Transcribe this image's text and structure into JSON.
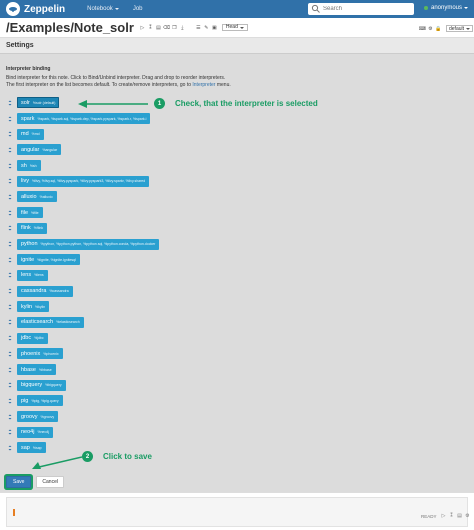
{
  "navbar": {
    "brand": "Zeppelin",
    "notebook_label": "Notebook",
    "job_label": "Job",
    "search_placeholder": "Search",
    "user": "anonymous",
    "brand_color": "#3071a9"
  },
  "note": {
    "title": "/Examples/Note_solr",
    "head_label": "Head",
    "default_label": "default"
  },
  "settings": {
    "title": "Settings",
    "binding_heading": "Interpreter binding",
    "desc_line1": "Bind interpreter for this note. Click to Bind/Unbind interpreter. Drag and drop to reorder interpreters.",
    "desc_line2_prefix": "The first interpreter on the list becomes default. To create/remove interpreters, go to ",
    "desc_link": "Interpreter",
    "desc_line2_suffix": " menu.",
    "interpreters": [
      {
        "name": "solr",
        "sub": "%solr (default)",
        "selected": true
      },
      {
        "name": "spark",
        "sub": "%spark, %spark.sql, %spark.dep, %spark.pyspark, %spark.r, %spark.i"
      },
      {
        "name": "md",
        "sub": "%md"
      },
      {
        "name": "angular",
        "sub": "%angular"
      },
      {
        "name": "sh",
        "sub": "%sh"
      },
      {
        "name": "livy",
        "sub": "%livy, %livy.sql, %livy.pyspark, %livy.pyspark3, %livy.sparkr, %livy.shared"
      },
      {
        "name": "alluxio",
        "sub": "%alluxio"
      },
      {
        "name": "file",
        "sub": "%file"
      },
      {
        "name": "flink",
        "sub": "%flink"
      },
      {
        "name": "python",
        "sub": "%python, %python.python, %python.sql, %python.conda, %python.docker"
      },
      {
        "name": "ignite",
        "sub": "%ignite, %ignite.ignitesql"
      },
      {
        "name": "lens",
        "sub": "%lens"
      },
      {
        "name": "cassandra",
        "sub": "%cassandra"
      },
      {
        "name": "kylin",
        "sub": "%kylin"
      },
      {
        "name": "elasticsearch",
        "sub": "%elasticsearch"
      },
      {
        "name": "jdbc",
        "sub": "%jdbc"
      },
      {
        "name": "phoenix",
        "sub": "%phoenix"
      },
      {
        "name": "hbase",
        "sub": "%hbase"
      },
      {
        "name": "bigquery",
        "sub": "%bigquery"
      },
      {
        "name": "pig",
        "sub": "%pig, %pig.query"
      },
      {
        "name": "groovy",
        "sub": "%groovy"
      },
      {
        "name": "neo4j",
        "sub": "%neo4j"
      },
      {
        "name": "sap",
        "sub": "%sap"
      }
    ],
    "save_label": "Save",
    "cancel_label": "Cancel"
  },
  "annotations": {
    "step1_number": "1",
    "step1_text": "Check, that the interpreter is selected",
    "step2_number": "2",
    "step2_text": "Click to save",
    "color": "#1a9c64"
  },
  "paragraph": {
    "status": "READY"
  }
}
